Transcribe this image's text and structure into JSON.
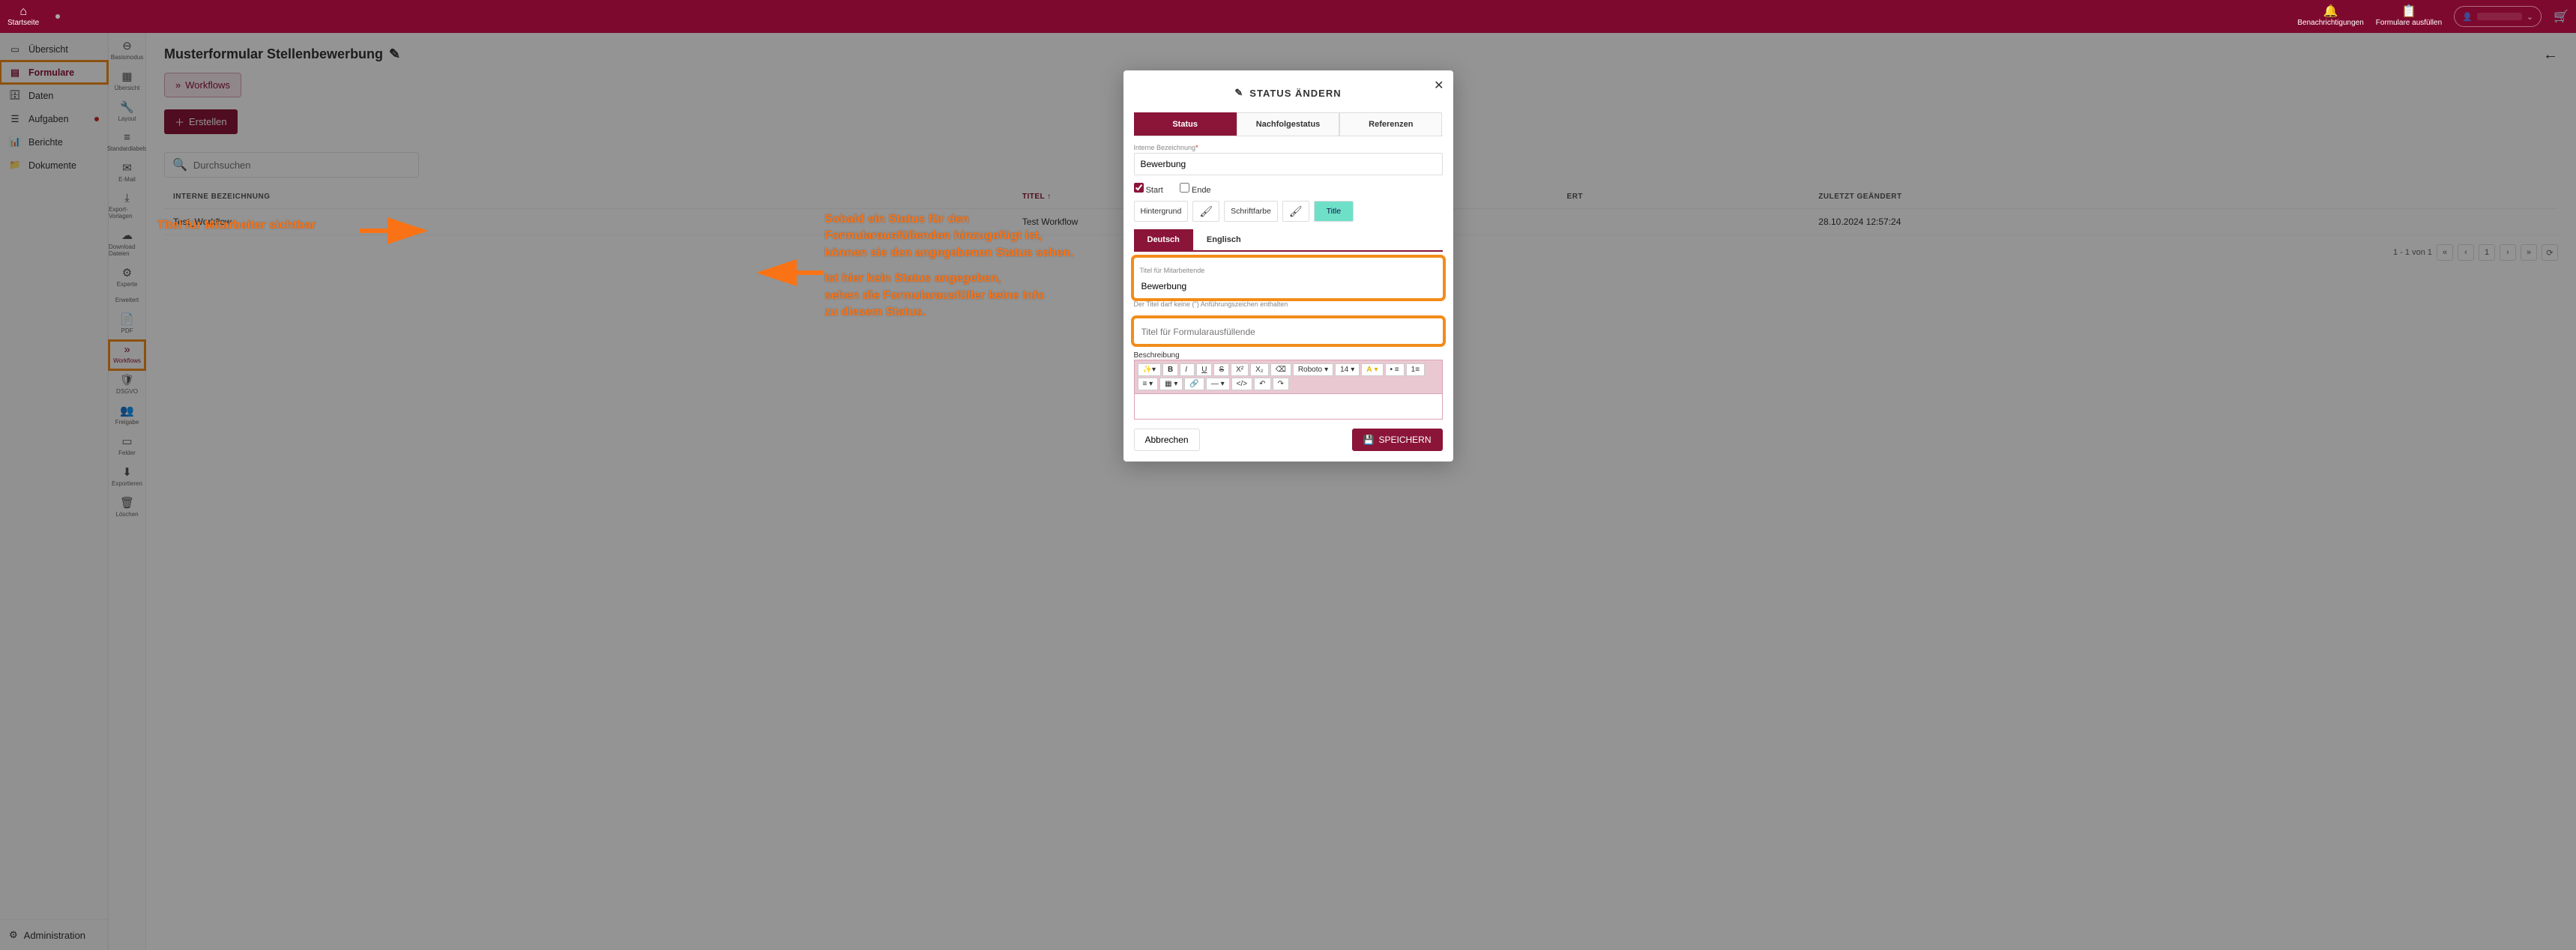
{
  "topbar": {
    "home_label": "Startseite",
    "notifications_label": "Benachrichtigungen",
    "forms_fill_label": "Formulare ausfüllen"
  },
  "sidebar": {
    "items": [
      {
        "label": "Übersicht"
      },
      {
        "label": "Formulare"
      },
      {
        "label": "Daten"
      },
      {
        "label": "Aufgaben"
      },
      {
        "label": "Berichte"
      },
      {
        "label": "Dokumente"
      }
    ],
    "admin_label": "Administration"
  },
  "subbar": {
    "items": [
      {
        "label": "Basismodus"
      },
      {
        "label": "Übersicht"
      },
      {
        "label": "Layout"
      },
      {
        "label": "Standardlabels"
      },
      {
        "label": "E-Mail"
      },
      {
        "label": "Export-Vorlagen"
      },
      {
        "label": "Download Dateien"
      },
      {
        "label": "Experte"
      },
      {
        "label": "Erweitert"
      },
      {
        "label": "PDF"
      },
      {
        "label": "Workflows"
      },
      {
        "label": "DSGVO"
      },
      {
        "label": "Freigabe"
      },
      {
        "label": "Felder"
      },
      {
        "label": "Exportieren"
      },
      {
        "label": "Löschen"
      }
    ]
  },
  "page": {
    "title": "Musterformular Stellenbewerbung",
    "workflows_btn": "Workflows",
    "create_btn": "Erstellen",
    "search_ph": "Durchsuchen",
    "table": {
      "cols": [
        "INTERNE BEZEICHNUNG",
        "TITEL",
        "ERT",
        "ZULETZT GEÄNDERT"
      ],
      "rows": [
        [
          "Test_Workflow",
          "Test Workflow",
          "",
          "28.10.2024 12:57:24"
        ]
      ]
    },
    "pager_text": "1 - 1 von 1"
  },
  "modal": {
    "title": "STATUS ÄNDERN",
    "tabs": [
      "Status",
      "Nachfolgestatus",
      "Referenzen"
    ],
    "internal_label": "Interne Bezeichnung",
    "internal_value": "Bewerbung",
    "cb_start": "Start",
    "cb_end": "Ende",
    "hintergrund": "Hintergrund",
    "schriftfarbe": "Schriftfarbe",
    "title_chip": "Title",
    "langtabs": [
      "Deutsch",
      "Englisch"
    ],
    "titel_mitarbeitende_label": "Titel für Mitarbeitende",
    "titel_mitarbeitende_value": "Bewerbung",
    "titel_note": "Der Titel darf keine (\") Anführungszeichen enthalten",
    "titel_formausfull_ph": "Titel für Formularausfüllende",
    "beschreibung_label": "Beschreibung",
    "rte_font": "Roboto",
    "rte_size": "14",
    "cancel": "Abbrechen",
    "save": "SPEICHERN"
  },
  "annotations": {
    "left": "Titel für Mitarbeiter sichtbar",
    "right_1": "Sobald ein Status für den",
    "right_2": "Formularausfüllenden hinzugefügt ist,",
    "right_3": "können sie den angegebenen Status sehen.",
    "right_4": "Ist hier kein Status angegeben,",
    "right_5": "sehen die Formularausfüller keine Info",
    "right_6": "zu diesem Status."
  }
}
